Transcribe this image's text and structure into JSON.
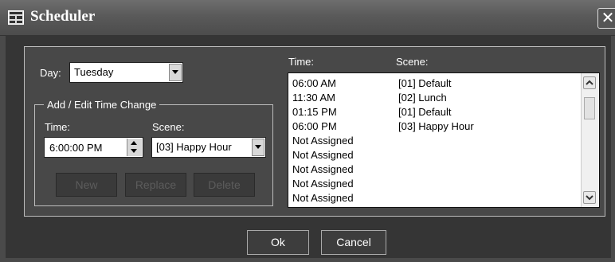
{
  "window": {
    "title": "Scheduler",
    "close_symbol": "✕"
  },
  "day": {
    "label": "Day:",
    "value": "Tuesday"
  },
  "group": {
    "title": "Add / Edit Time Change",
    "time_label": "Time:",
    "scene_label": "Scene:",
    "time_value": "6:00:00 PM",
    "scene_value": "[03] Happy Hour"
  },
  "buttons": {
    "new": "New",
    "replace": "Replace",
    "delete": "Delete",
    "ok": "Ok",
    "cancel": "Cancel"
  },
  "list": {
    "col_time": "Time:",
    "col_scene": "Scene:",
    "rows": [
      {
        "time": "06:00 AM",
        "scene": "[01] Default"
      },
      {
        "time": "11:30 AM",
        "scene": "[02] Lunch"
      },
      {
        "time": "01:15 PM",
        "scene": "[01] Default"
      },
      {
        "time": "06:00 PM",
        "scene": "[03] Happy Hour"
      },
      {
        "time": "Not Assigned",
        "scene": ""
      },
      {
        "time": "Not Assigned",
        "scene": ""
      },
      {
        "time": "Not Assigned",
        "scene": ""
      },
      {
        "time": "Not Assigned",
        "scene": ""
      },
      {
        "time": "Not Assigned",
        "scene": ""
      }
    ]
  }
}
